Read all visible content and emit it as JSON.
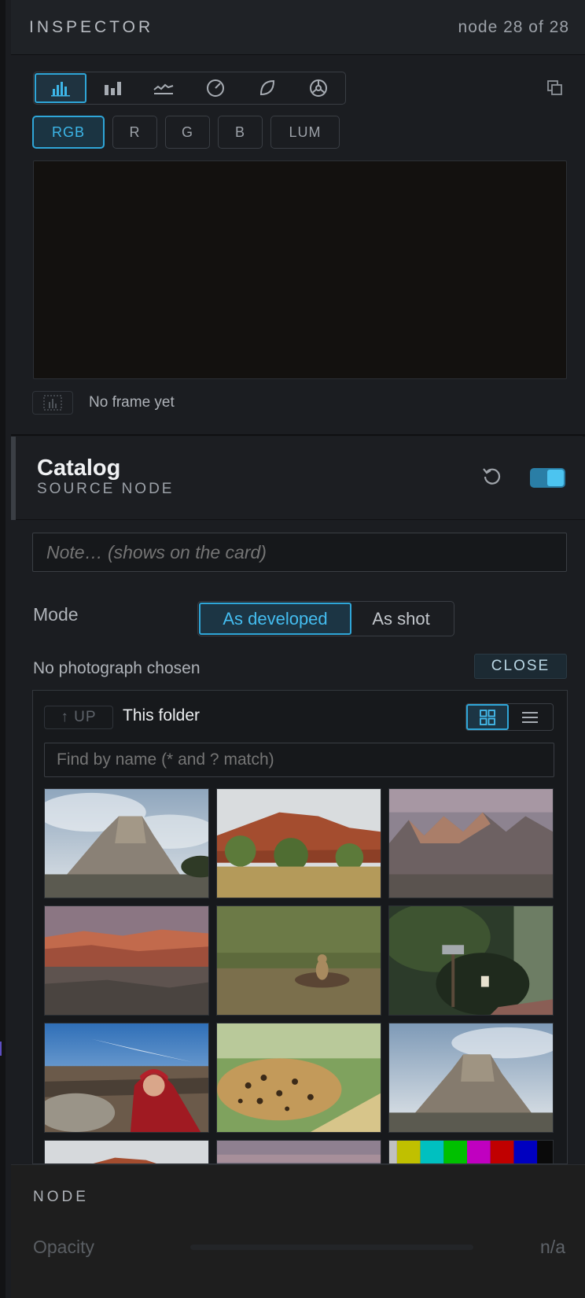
{
  "inspector": {
    "title": "INSPECTOR",
    "node_count": "node 28 of 28"
  },
  "scope": {
    "modes": [
      {
        "icon": "histogram-icon",
        "active": true
      },
      {
        "icon": "bar-parade-icon",
        "active": false
      },
      {
        "icon": "waveform-icon",
        "active": false
      },
      {
        "icon": "gauge-icon",
        "active": false
      },
      {
        "icon": "leaf-icon",
        "active": false
      },
      {
        "icon": "vectorscope-icon",
        "active": false
      }
    ],
    "popout_icon": "popout-icon",
    "channels": [
      "RGB",
      "R",
      "G",
      "B",
      "LUM"
    ],
    "active_channel": "RGB",
    "status_icon": "no-frame-icon",
    "status_text": "No frame yet"
  },
  "catalog": {
    "title": "Catalog",
    "subtitle": "SOURCE NODE",
    "reset_icon": "reset-icon",
    "enabled": true,
    "note_placeholder": "Note… (shows on the card)",
    "mode_label": "Mode",
    "mode_options": [
      "As developed",
      "As shot"
    ],
    "mode_selected": "As developed",
    "photo_status": "No photograph chosen",
    "close_label": "CLOSE",
    "browser": {
      "up_label": "↑ UP",
      "folder_label": "This folder",
      "view_modes": [
        "grid-view-icon",
        "list-view-icon"
      ],
      "active_view": "grid-view-icon",
      "search_placeholder": "Find by name (* and ? match)",
      "thumbnails": [
        {
          "subject": "butte-under-clouds"
        },
        {
          "subject": "red-rock-cliffs-trees"
        },
        {
          "subject": "eroded-badlands-dusk"
        },
        {
          "subject": "badlands-sunset"
        },
        {
          "subject": "prairie-dog-grass"
        },
        {
          "subject": "mossy-forest-lantern"
        },
        {
          "subject": "selfie-red-hoodie-canyon"
        },
        {
          "subject": "sleeping-cheetah"
        },
        {
          "subject": "butte-under-clouds"
        },
        {
          "subject": "red-rock-partial"
        },
        {
          "subject": "pink-sky-partial"
        },
        {
          "subject": "color-bars"
        }
      ]
    }
  },
  "node": {
    "title": "NODE",
    "opacity_label": "Opacity",
    "opacity_value": "n/a"
  },
  "colors": {
    "accent": "#2fa6d8",
    "panel_bg": "#1b1d21",
    "scope_bg": "#13110f"
  }
}
